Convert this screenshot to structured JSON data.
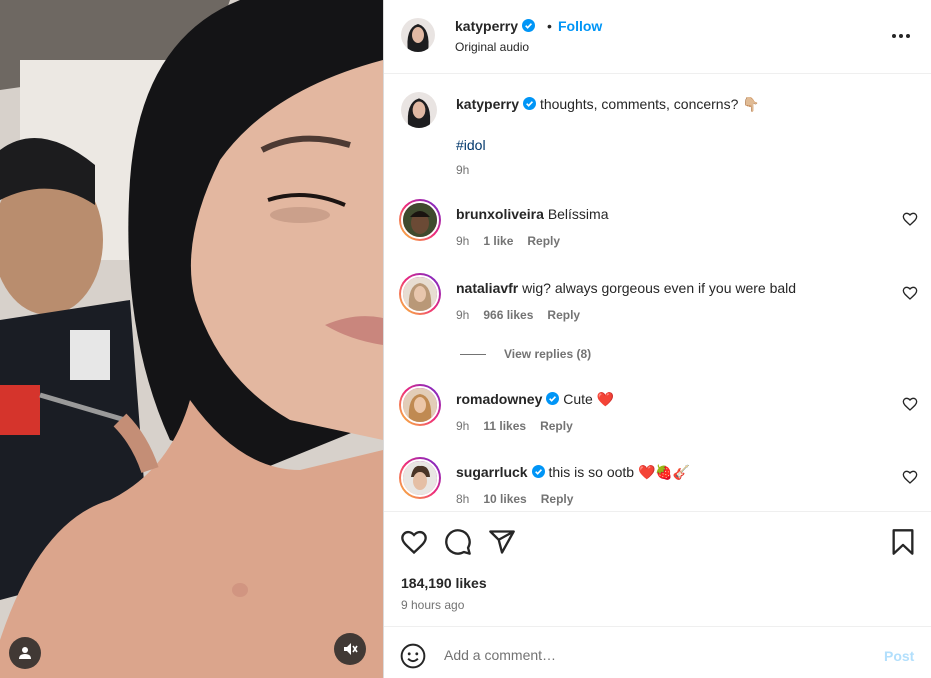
{
  "post": {
    "username": "katyperry",
    "follow_label": "Follow",
    "separator": "•",
    "audio": "Original audio",
    "caption": "thoughts, comments, concerns?",
    "caption_emoji": "👇🏼",
    "hashtag": "#idol",
    "posted": "9h",
    "likes": "184,190 likes",
    "time_ago": "9 hours ago"
  },
  "comments": [
    {
      "username": "brunxoliveira",
      "text": "Belíssima",
      "emoji": "",
      "verified": false,
      "time": "9h",
      "likes": "1 like",
      "reply": "Reply"
    },
    {
      "username": "nataliavfr",
      "text": "wig? always gorgeous even if you were bald",
      "emoji": "",
      "verified": false,
      "time": "9h",
      "likes": "966 likes",
      "reply": "Reply"
    },
    {
      "username": "romadowney",
      "text": "Cute",
      "emoji": "❤️",
      "verified": true,
      "time": "9h",
      "likes": "11 likes",
      "reply": "Reply"
    },
    {
      "username": "sugarrluck",
      "text": "this is so ootb",
      "emoji": "❤️🍓🎸",
      "verified": true,
      "time": "8h",
      "likes": "10 likes",
      "reply": "Reply"
    }
  ],
  "view_replies": "View replies (8)",
  "add_comment": {
    "placeholder": "Add a comment…",
    "post_label": "Post"
  },
  "colors": {
    "accent": "#0095f6",
    "verified": "#0095f6",
    "post_disabled": "#b2dffc",
    "heart_red": "#ed1c24"
  },
  "icons": [
    "more-icon",
    "heart-icon",
    "comment-icon",
    "share-icon",
    "bookmark-icon",
    "emoji-icon",
    "user-tag-icon",
    "mute-icon",
    "verified-icon"
  ]
}
